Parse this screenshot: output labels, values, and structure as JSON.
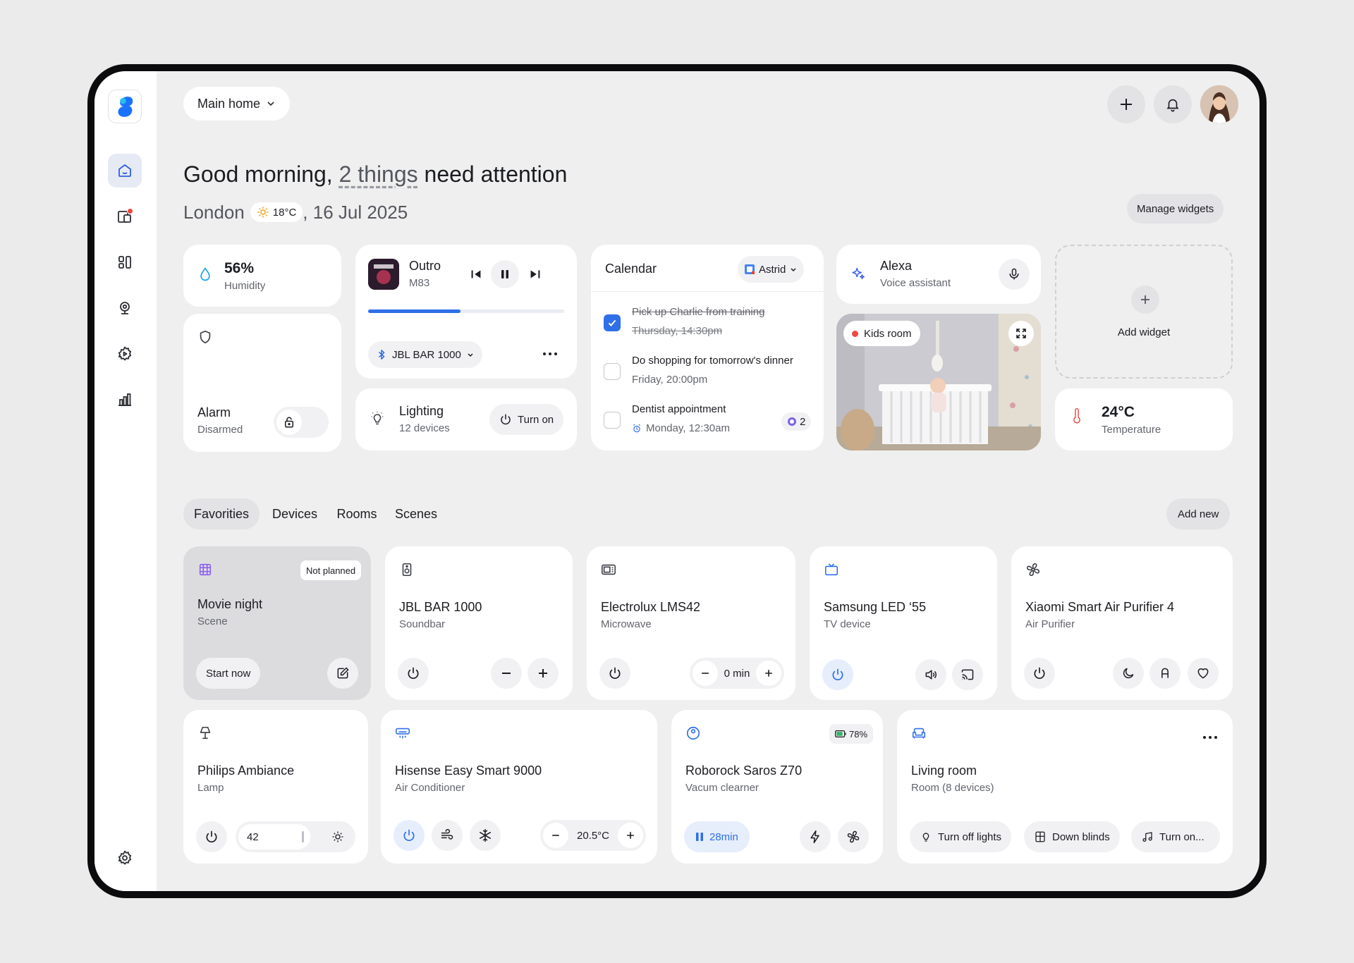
{
  "header": {
    "home_selector": "Main home",
    "greeting_prefix": "Good morning, ",
    "greeting_link": "2 things",
    "greeting_suffix": " need attention",
    "city": "London",
    "weather_temp": "18°C",
    "date": ", 16 Jul 2025",
    "manage_widgets": "Manage widgets"
  },
  "widgets": {
    "humidity": {
      "value": "56%",
      "label": "Humidity"
    },
    "alarm": {
      "title": "Alarm",
      "status": "Disarmed"
    },
    "music": {
      "track": "Outro",
      "artist": "M83",
      "progress": 0.47,
      "device": "JBL BAR 1000"
    },
    "lighting": {
      "title": "Lighting",
      "devices": "12 devices",
      "action": "Turn on"
    },
    "calendar": {
      "title": "Calendar",
      "account": "Astrid",
      "events": [
        {
          "title": "Pick up Charlie from training",
          "time": "Thursday, 14:30pm",
          "done": true
        },
        {
          "title": "Do shopping for tomorrow's dinner",
          "time": "Friday, 20:00pm",
          "done": false
        },
        {
          "title": "Dentist appointment",
          "time": "Monday, 12:30am",
          "done": false,
          "attendees": "2"
        }
      ]
    },
    "alexa": {
      "title": "Alexa",
      "subtitle": "Voice assistant"
    },
    "camera": {
      "label": "Kids room"
    },
    "add_widget": "Add widget",
    "temperature": {
      "value": "24°C",
      "label": "Temperature"
    }
  },
  "tabs": {
    "items": [
      "Favorities",
      "Devices",
      "Rooms",
      "Scenes"
    ],
    "active": "Favorities",
    "add_new": "Add new"
  },
  "devices": {
    "movie": {
      "name": "Movie night",
      "type": "Scene",
      "badge": "Not planned",
      "action": "Start now"
    },
    "jbl": {
      "name": "JBL BAR 1000",
      "type": "Soundbar"
    },
    "electrolux": {
      "name": "Electrolux LMS42",
      "type": "Microwave",
      "timer": "0 min"
    },
    "samsung": {
      "name": "Samsung LED ‘55",
      "type": "TV device"
    },
    "xiaomi": {
      "name": "Xiaomi Smart Air Purifier 4",
      "type": "Air Purifier"
    },
    "philips": {
      "name": "Philips Ambiance",
      "type": "Lamp",
      "brightness": "42"
    },
    "hisense": {
      "name": "Hisense Easy Smart 9000",
      "type": "Air Conditioner",
      "temp": "20.5°C"
    },
    "roborock": {
      "name": "Roborock Saros Z70",
      "type": "Vacum clearner",
      "battery": "78%",
      "timer": "28min"
    },
    "living": {
      "name": "Living room",
      "type": "Room (8 devices)",
      "actions": [
        "Turn off lights",
        "Down blinds",
        "Turn on..."
      ]
    }
  },
  "colors": {
    "accent": "#2f6fe8",
    "alert": "#f0473e",
    "thermo": "#e8453c",
    "humidity": "#1aa6e6"
  }
}
